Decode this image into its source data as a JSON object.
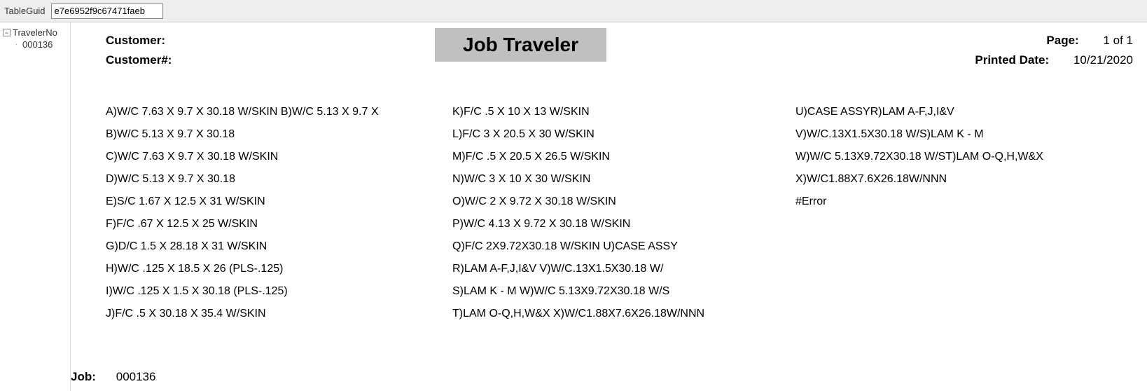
{
  "toolbar": {
    "label": "TableGuid",
    "value": "e7e6952f9c67471faeb"
  },
  "sidebar": {
    "root_label": "TravelerNo",
    "child_label": "000136"
  },
  "report": {
    "customer_label": "Customer:",
    "customer_num_label": "Customer#:",
    "title": "Job Traveler",
    "page_label": "Page:",
    "page_value": "1 of 1",
    "printed_label": "Printed Date:",
    "printed_value": "10/21/2020",
    "job_label": "Job:",
    "job_value": "000136",
    "col1": [
      "A)W/C 7.63 X 9.7 X 30.18 W/SKIN B)W/C 5.13 X 9.7 X",
      "B)W/C 5.13 X 9.7 X 30.18",
      "C)W/C 7.63 X 9.7 X 30.18 W/SKIN",
      "D)W/C 5.13 X 9.7 X 30.18",
      "E)S/C 1.67 X 12.5 X 31 W/SKIN",
      "F)F/C .67 X 12.5 X 25 W/SKIN",
      "G)D/C 1.5 X 28.18 X 31 W/SKIN",
      "H)W/C .125 X 18.5 X 26 (PLS-.125)",
      "I)W/C .125 X 1.5 X 30.18 (PLS-.125)",
      "J)F/C .5 X 30.18 X 35.4 W/SKIN"
    ],
    "col2": [
      "K)F/C .5 X 10 X 13 W/SKIN",
      "L)F/C 3 X 20.5 X 30 W/SKIN",
      "M)F/C .5 X 20.5 X 26.5 W/SKIN",
      "N)W/C 3 X 10 X 30 W/SKIN",
      "O)W/C 2 X 9.72 X 30.18 W/SKIN",
      "P)W/C 4.13 X 9.72 X 30.18 W/SKIN",
      "Q)F/C 2X9.72X30.18 W/SKIN U)CASE ASSY",
      "R)LAM A-F,J,I&V V)W/C.13X1.5X30.18 W/",
      "S)LAM K - M W)W/C 5.13X9.72X30.18 W/S",
      "T)LAM O-Q,H,W&X X)W/C1.88X7.6X26.18W/NNN"
    ],
    "col3": [
      "U)CASE ASSYR)LAM A-F,J,I&V",
      "V)W/C.13X1.5X30.18 W/S)LAM K - M",
      "W)W/C 5.13X9.72X30.18 W/ST)LAM O-Q,H,W&X",
      "X)W/C1.88X7.6X26.18W/NNN",
      "#Error"
    ]
  }
}
